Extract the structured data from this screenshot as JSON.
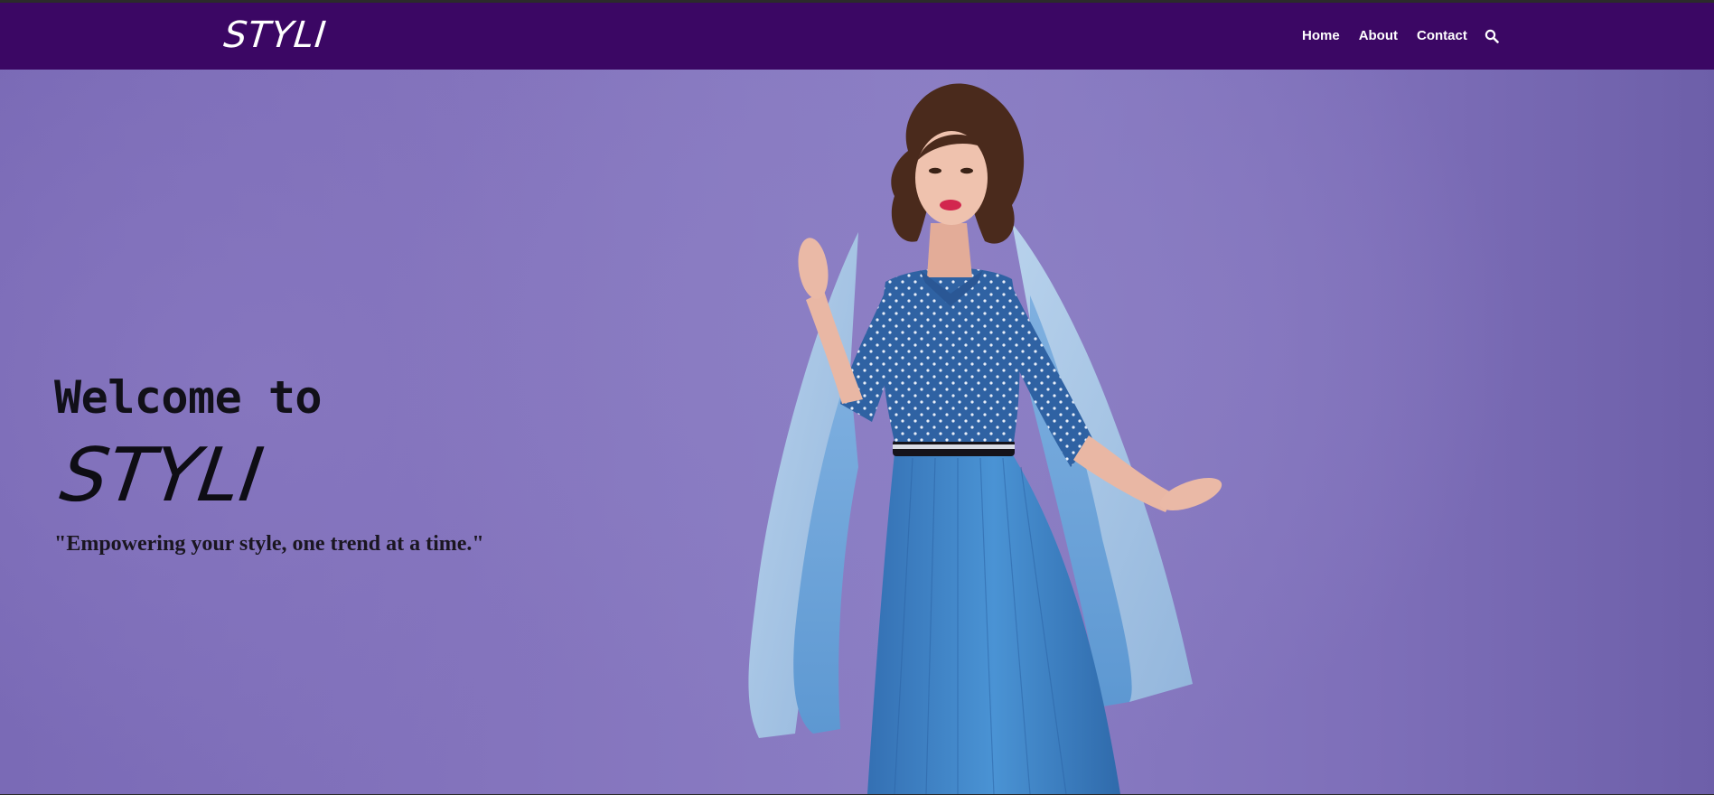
{
  "navbar": {
    "brand": "STYLI",
    "links": [
      {
        "label": "Home"
      },
      {
        "label": "About"
      },
      {
        "label": "Contact"
      }
    ],
    "search_icon": "search-icon"
  },
  "hero": {
    "welcome": "Welcome to",
    "brand": "STYLI",
    "tagline": "\"Empowering your style, one trend at a time.\"",
    "image": "model-photo"
  },
  "colors": {
    "navbar": "#3b0764",
    "hero_background": "#8676bf",
    "nav_text": "#ffffff",
    "hero_text": "#111018",
    "dress": "#3f86c7",
    "coat": "#a9c7e6",
    "blouse": "#2e5e9b"
  }
}
